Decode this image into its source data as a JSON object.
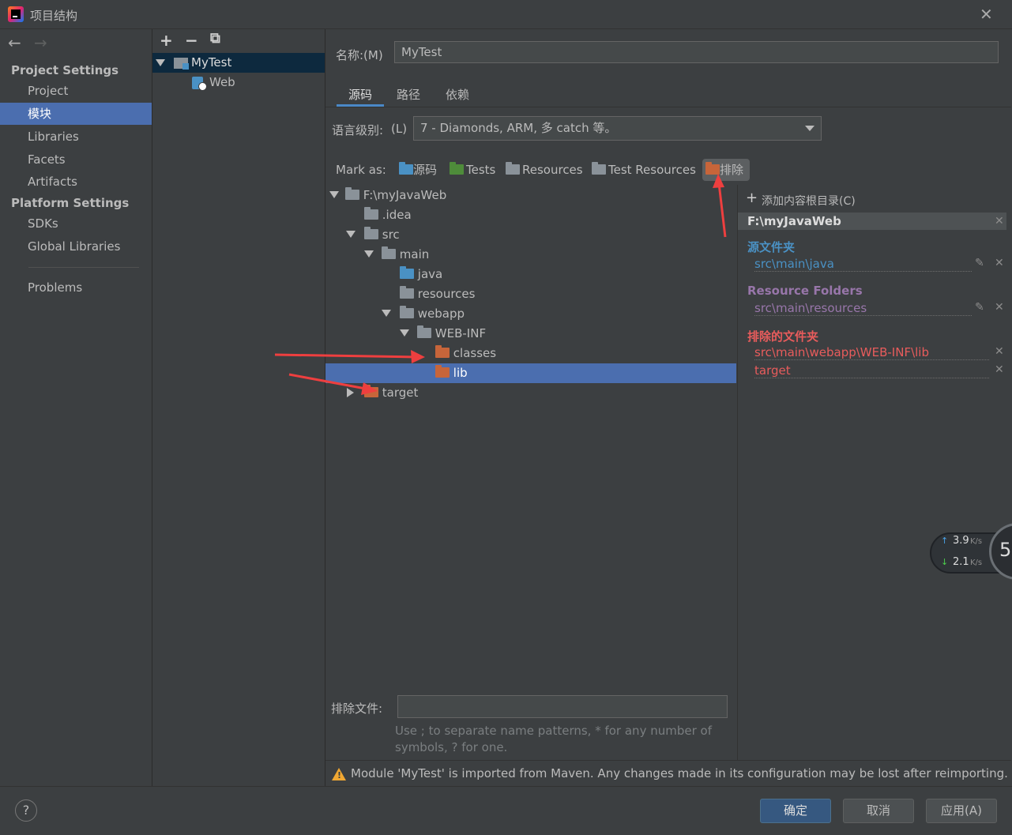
{
  "window": {
    "title": "项目结构",
    "close": "✕"
  },
  "nav": {
    "back": "←",
    "forward": "→",
    "project_settings": "Project Settings",
    "items_project": [
      "Project",
      "模块",
      "Libraries",
      "Facets",
      "Artifacts"
    ],
    "platform_settings": "Platform Settings",
    "items_platform": [
      "SDKs",
      "Global Libraries"
    ],
    "problems": "Problems"
  },
  "modules": {
    "add": "+",
    "remove": "−",
    "copy": "⧉",
    "tree": [
      {
        "label": "MyTest"
      },
      {
        "label": "Web"
      }
    ]
  },
  "main": {
    "name_label": "名称:(M)",
    "name_value": "MyTest",
    "tabs": [
      "源码",
      "路径",
      "依赖"
    ],
    "lang_label": "语言级别:",
    "lang_mnemonic": "(L)",
    "lang_value": "7 - Diamonds, ARM, 多 catch 等。",
    "mark_as_label": "Mark as:",
    "mark_buttons": [
      "源码",
      "Tests",
      "Resources",
      "Test Resources",
      "排除"
    ],
    "file_tree": [
      {
        "label": "F:\\myJavaWeb"
      },
      {
        "label": ".idea"
      },
      {
        "label": "src"
      },
      {
        "label": "main"
      },
      {
        "label": "java"
      },
      {
        "label": "resources"
      },
      {
        "label": "webapp"
      },
      {
        "label": "WEB-INF"
      },
      {
        "label": "classes"
      },
      {
        "label": "lib"
      },
      {
        "label": "target"
      }
    ],
    "exclude_files_label": "排除文件:",
    "exclude_hint_1": "Use ; to separate name patterns, * for any number of",
    "exclude_hint_2": "symbols, ? for one.",
    "warning": "Module 'MyTest' is imported from Maven. Any changes made in its configuration may be lost after reimporting."
  },
  "content_roots": {
    "add_label": "添加内容根目录(C)",
    "root": "F:\\myJavaWeb",
    "source_title": "源文件夹",
    "source_items": [
      "src\\main\\java"
    ],
    "resource_title": "Resource Folders",
    "resource_items": [
      "src\\main\\resources"
    ],
    "excluded_title": "排除的文件夹",
    "excluded_items": [
      "src\\main\\webapp\\WEB-INF\\lib",
      "target"
    ]
  },
  "buttons": {
    "help": "?",
    "ok": "确定",
    "cancel": "取消",
    "apply": "应用(A)"
  },
  "network": {
    "up": "3.9",
    "down": "2.1",
    "unit": "K/s",
    "badge": "5"
  },
  "colors": {
    "selection": "#4b6eaf",
    "source_blue": "#4a91c4",
    "excluded": "#c7653a",
    "resource_purple": "#9876aa",
    "excluded_red": "#e85c5c"
  }
}
